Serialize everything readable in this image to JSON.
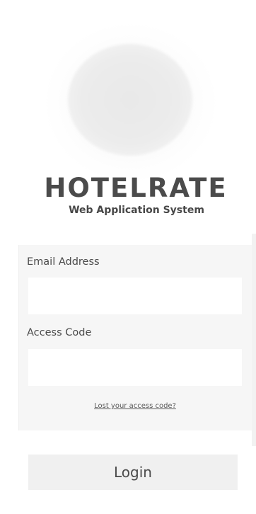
{
  "brand": {
    "logo_icon": "hotel-logo-circle",
    "title": "HOTELRATE",
    "subtitle": "Web Application System"
  },
  "form": {
    "email_label": "Email Address",
    "email_value": "",
    "access_code_label": "Access Code",
    "access_code_value": "",
    "lost_code_link": "Lost your access code?",
    "login_button": "Login"
  }
}
